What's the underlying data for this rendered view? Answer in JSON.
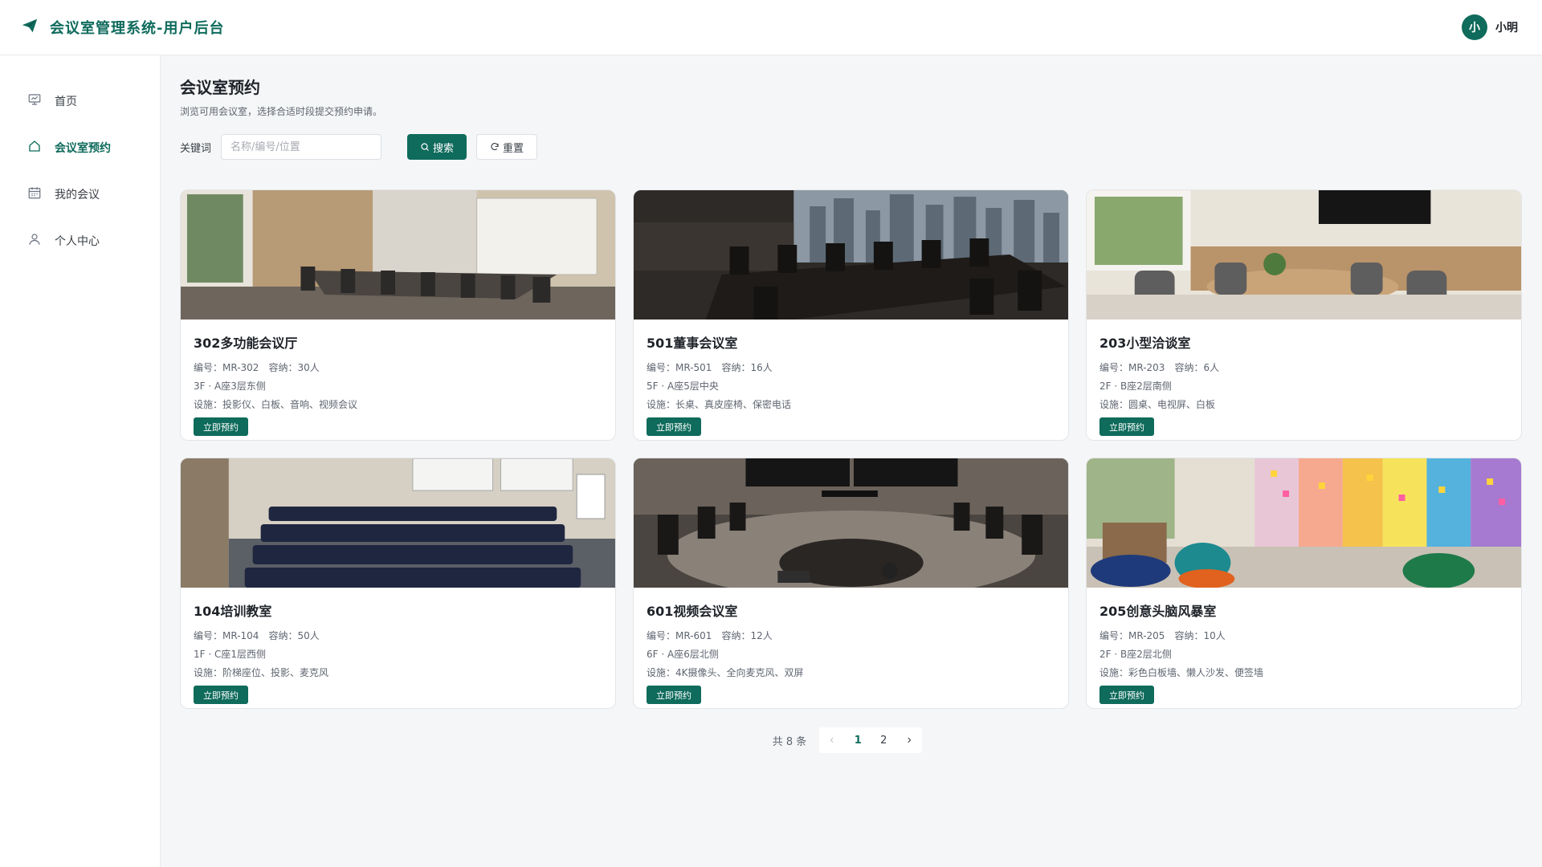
{
  "header": {
    "title": "会议室管理系统-用户后台",
    "avatar_text": "小",
    "user_name": "小明"
  },
  "sidebar": {
    "items": [
      {
        "label": "首页",
        "icon": "presentation-icon"
      },
      {
        "label": "会议室预约",
        "icon": "home-icon",
        "active": true
      },
      {
        "label": "我的会议",
        "icon": "calendar-icon"
      },
      {
        "label": "个人中心",
        "icon": "user-icon"
      }
    ]
  },
  "page": {
    "title": "会议室预约",
    "description": "浏览可用会议室，选择合适时段提交预约申请。"
  },
  "search": {
    "label": "关键词",
    "placeholder": "名称/编号/位置",
    "value": "",
    "search_label": "搜索",
    "reset_label": "重置"
  },
  "rooms": [
    {
      "name": "302多功能会议厅",
      "code": "编号：MR-302",
      "capacity": "容纳：30人",
      "location": "3F · A座3层东侧",
      "facilities": "设施：投影仪、白板、音响、视频会议",
      "button": "立即预约"
    },
    {
      "name": "501董事会议室",
      "code": "编号：MR-501",
      "capacity": "容纳：16人",
      "location": "5F · A座5层中央",
      "facilities": "设施：长桌、真皮座椅、保密电话",
      "button": "立即预约"
    },
    {
      "name": "203小型洽谈室",
      "code": "编号：MR-203",
      "capacity": "容纳：6人",
      "location": "2F · B座2层南侧",
      "facilities": "设施：圆桌、电视屏、白板",
      "button": "立即预约"
    },
    {
      "name": "104培训教室",
      "code": "编号：MR-104",
      "capacity": "容纳：50人",
      "location": "1F · C座1层西侧",
      "facilities": "设施：阶梯座位、投影、麦克风",
      "button": "立即预约"
    },
    {
      "name": "601视频会议室",
      "code": "编号：MR-601",
      "capacity": "容纳：12人",
      "location": "6F · A座6层北侧",
      "facilities": "设施：4K摄像头、全向麦克风、双屏",
      "button": "立即预约"
    },
    {
      "name": "205创意头脑风暴室",
      "code": "编号：MR-205",
      "capacity": "容纳：10人",
      "location": "2F · B座2层北侧",
      "facilities": "设施：彩色白板墙、懒人沙发、便签墙",
      "button": "立即预约"
    }
  ],
  "pagination": {
    "total": "共 8 条",
    "pages": [
      "1",
      "2"
    ],
    "current": "1",
    "prev_icon": "chevron-left-icon",
    "next_icon": "chevron-right-icon"
  },
  "colors": {
    "primary": "#0f6b5c",
    "background": "#f5f6f7"
  }
}
